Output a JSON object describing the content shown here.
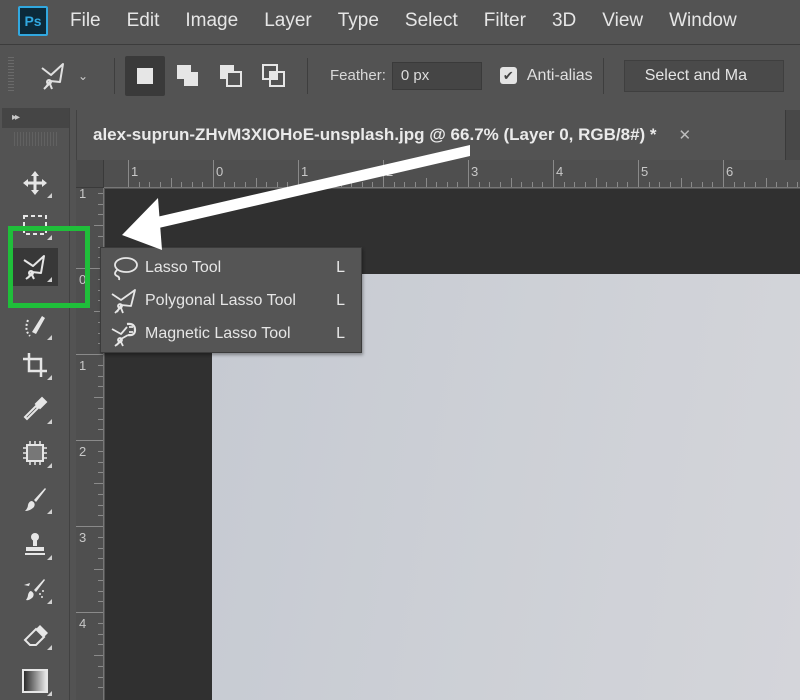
{
  "app": {
    "logo_text": "Ps",
    "brand_color": "#31a8e0"
  },
  "menu": {
    "items": [
      "File",
      "Edit",
      "Image",
      "Layer",
      "Type",
      "Select",
      "Filter",
      "3D",
      "View",
      "Window"
    ]
  },
  "options": {
    "feather_label": "Feather:",
    "feather_value": "0 px",
    "anti_alias_label": "Anti-alias",
    "anti_alias_checked": true,
    "select_mask_label": "Select and Ma",
    "selection_modes": [
      "new-selection",
      "add-to-selection",
      "subtract-from-selection",
      "intersect-with-selection"
    ],
    "active_mode": "new-selection"
  },
  "toolbar": {
    "header": "▸▸",
    "tools": [
      {
        "name": "move-tool",
        "icon": "move-icon"
      },
      {
        "name": "rectangular-marquee-tool",
        "icon": "marquee-icon"
      },
      {
        "name": "lasso-tool",
        "icon": "polygonal-lasso-icon",
        "active": true
      },
      {
        "name": "quick-selection-tool",
        "icon": "quick-selection-icon"
      },
      {
        "name": "crop-tool",
        "icon": "crop-icon"
      },
      {
        "name": "eyedropper-tool",
        "icon": "eyedropper-icon"
      },
      {
        "name": "spot-healing-tool",
        "icon": "healing-icon"
      },
      {
        "name": "brush-tool",
        "icon": "brush-icon"
      },
      {
        "name": "clone-stamp-tool",
        "icon": "stamp-icon"
      },
      {
        "name": "history-brush-tool",
        "icon": "history-brush-icon"
      },
      {
        "name": "eraser-tool",
        "icon": "eraser-icon"
      },
      {
        "name": "gradient-tool",
        "icon": "gradient-icon"
      }
    ],
    "highlight_color": "#1fbf3a"
  },
  "document": {
    "title": "alex-suprun-ZHvM3XIOHoE-unsplash.jpg @ 66.7% (Layer 0, RGB/8#) *",
    "close": "✕",
    "zoom": "66.7%"
  },
  "rulers": {
    "horizontal_labels": [
      "1",
      "0",
      "1",
      "2",
      "3",
      "4",
      "5",
      "6"
    ],
    "vertical_labels": [
      "1",
      "0",
      "1",
      "2",
      "3",
      "4"
    ]
  },
  "flyout": {
    "items": [
      {
        "label": "Lasso Tool",
        "shortcut": "L",
        "icon": "lasso-icon"
      },
      {
        "label": "Polygonal Lasso Tool",
        "shortcut": "L",
        "icon": "polygonal-lasso-icon"
      },
      {
        "label": "Magnetic Lasso Tool",
        "shortcut": "L",
        "icon": "magnetic-lasso-icon"
      }
    ]
  }
}
